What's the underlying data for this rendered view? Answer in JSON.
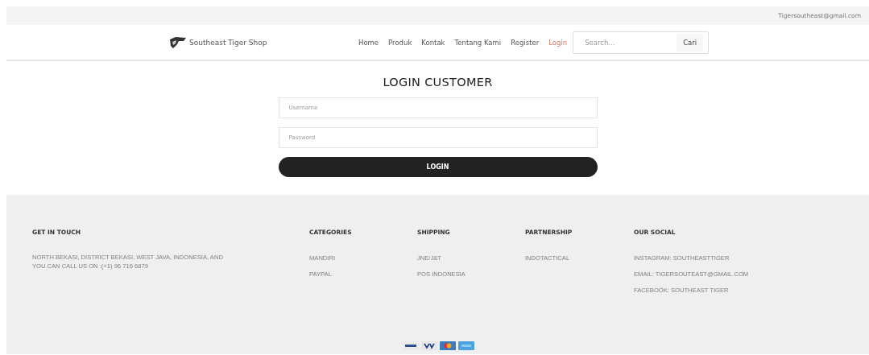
{
  "top_bar": {
    "email": "Tigersoutheast@gmail.com"
  },
  "header": {
    "brand": "Southeast Tiger Shop",
    "nav": [
      {
        "label": "Home",
        "selected": false
      },
      {
        "label": "Produk",
        "selected": false
      },
      {
        "label": "Kontak",
        "selected": false
      },
      {
        "label": "Tentang Kami",
        "selected": false
      },
      {
        "label": "Register",
        "selected": false
      },
      {
        "label": "Login",
        "selected": true
      }
    ],
    "search": {
      "placeholder": "Search...",
      "button": "Cari"
    }
  },
  "login": {
    "title": "LOGIN CUSTOMER",
    "fields": [
      {
        "placeholder": "Username"
      },
      {
        "placeholder": "Password"
      }
    ],
    "button": "LOGIN"
  },
  "footer": {
    "columns": [
      {
        "heading": "GET IN TOUCH",
        "items": [
          "NORTH BEKASI, DISTRICT BEKASI, WEST JAVA, INDONESIA, AND YOU CAN CALL US ON :(+1) 96 716 6879"
        ]
      },
      {
        "heading": "CATEGORIES",
        "items": [
          "MANDIRI",
          "PAYPAL"
        ]
      },
      {
        "heading": "SHIPPING",
        "items": [
          "JNE/J&T",
          "POS INDONESIA"
        ]
      },
      {
        "heading": "PARTNERSHIP",
        "items": [
          "INDOTACTICAL"
        ]
      },
      {
        "heading": "OUR SOCIAL",
        "items": [
          "INSTAGRAM: SOUTHEASTTIGER",
          "EMAIL: TIGERSOUTEAST@GMAIL.COM",
          "FACEBOOK: SOUTHEAST TIGER"
        ]
      }
    ],
    "payment_cards": [
      {
        "kind": "paypal"
      },
      {
        "kind": "visa"
      },
      {
        "kind": "mastercard"
      },
      {
        "kind": "amex"
      }
    ]
  }
}
